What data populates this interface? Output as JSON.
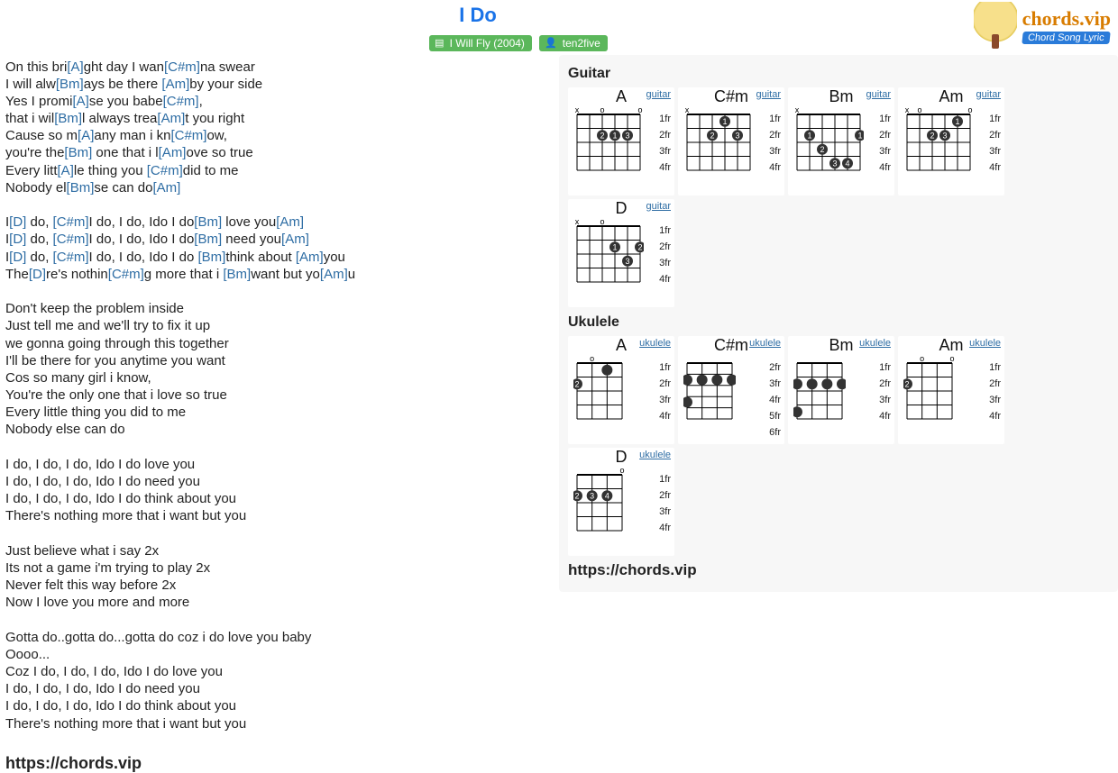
{
  "header": {
    "title": "I Do",
    "album_badge": "I Will Fly (2004)",
    "artist_badge": "ten2five",
    "logo_line1": "chords.vip",
    "logo_line2": "Chord Song Lyric"
  },
  "colors": {
    "chord": "#2e6da4",
    "badge_bg": "#5bb75b",
    "title": "#1a73e8"
  },
  "lyrics": [
    [
      [
        "On this bri",
        null
      ],
      [
        "[A]",
        "c"
      ],
      [
        "ght day I wan",
        null
      ],
      [
        "[C#m]",
        "c"
      ],
      [
        "na swear",
        null
      ]
    ],
    [
      [
        "I will alw",
        null
      ],
      [
        "[Bm]",
        "c"
      ],
      [
        "ays be there ",
        null
      ],
      [
        "[Am]",
        "c"
      ],
      [
        "by your side",
        null
      ]
    ],
    [
      [
        "Yes I promi",
        null
      ],
      [
        "[A]",
        "c"
      ],
      [
        "se you babe",
        null
      ],
      [
        "[C#m]",
        "c"
      ],
      [
        ",",
        null
      ]
    ],
    [
      [
        "that i wil",
        null
      ],
      [
        "[Bm]",
        "c"
      ],
      [
        "l always trea",
        null
      ],
      [
        "[Am]",
        "c"
      ],
      [
        "t you right",
        null
      ]
    ],
    [
      [
        "Cause so m",
        null
      ],
      [
        "[A]",
        "c"
      ],
      [
        "any man i kn",
        null
      ],
      [
        "[C#m]",
        "c"
      ],
      [
        "ow,",
        null
      ]
    ],
    [
      [
        "you're the",
        null
      ],
      [
        "[Bm]",
        "c"
      ],
      [
        " one that i l",
        null
      ],
      [
        "[Am]",
        "c"
      ],
      [
        "ove so true",
        null
      ]
    ],
    [
      [
        "Every litt",
        null
      ],
      [
        "[A]",
        "c"
      ],
      [
        "le thing you ",
        null
      ],
      [
        "[C#m]",
        "c"
      ],
      [
        "did to me",
        null
      ]
    ],
    [
      [
        "Nobody el",
        null
      ],
      [
        "[Bm]",
        "c"
      ],
      [
        "se can do",
        null
      ],
      [
        "[Am]",
        "c"
      ]
    ],
    [
      [
        "",
        null
      ]
    ],
    [
      [
        "I",
        null
      ],
      [
        "[D]",
        "c"
      ],
      [
        " do, ",
        null
      ],
      [
        "[C#m]",
        "c"
      ],
      [
        "I do, I do, Ido I do",
        null
      ],
      [
        "[Bm]",
        "c"
      ],
      [
        " love you",
        null
      ],
      [
        "[Am]",
        "c"
      ]
    ],
    [
      [
        "I",
        null
      ],
      [
        "[D]",
        "c"
      ],
      [
        " do, ",
        null
      ],
      [
        "[C#m]",
        "c"
      ],
      [
        "I do, I do, Ido I do",
        null
      ],
      [
        "[Bm]",
        "c"
      ],
      [
        " need you",
        null
      ],
      [
        "[Am]",
        "c"
      ]
    ],
    [
      [
        "I",
        null
      ],
      [
        "[D]",
        "c"
      ],
      [
        " do, ",
        null
      ],
      [
        "[C#m]",
        "c"
      ],
      [
        "I do, I do, Ido I do ",
        null
      ],
      [
        "[Bm]",
        "c"
      ],
      [
        "think about ",
        null
      ],
      [
        "[Am]",
        "c"
      ],
      [
        "you",
        null
      ]
    ],
    [
      [
        "The",
        null
      ],
      [
        "[D]",
        "c"
      ],
      [
        "re's nothin",
        null
      ],
      [
        "[C#m]",
        "c"
      ],
      [
        "g more that i ",
        null
      ],
      [
        "[Bm]",
        "c"
      ],
      [
        "want but yo",
        null
      ],
      [
        "[Am]",
        "c"
      ],
      [
        "u",
        null
      ]
    ],
    [
      [
        "",
        null
      ]
    ],
    [
      [
        "Don't keep the problem inside",
        null
      ]
    ],
    [
      [
        "Just tell me and we'll try to fix it up",
        null
      ]
    ],
    [
      [
        "we gonna going through this together",
        null
      ]
    ],
    [
      [
        "I'll be there for you anytime you want",
        null
      ]
    ],
    [
      [
        "Cos so many girl i know,",
        null
      ]
    ],
    [
      [
        "You're the only one that i love so true",
        null
      ]
    ],
    [
      [
        "Every little thing you did to me",
        null
      ]
    ],
    [
      [
        "Nobody else can do",
        null
      ]
    ],
    [
      [
        "",
        null
      ]
    ],
    [
      [
        "I do, I do, I do, Ido I do love you",
        null
      ]
    ],
    [
      [
        "I do, I do, I do, Ido I do need you",
        null
      ]
    ],
    [
      [
        "I do, I do, I do, Ido I do think about you",
        null
      ]
    ],
    [
      [
        "There's nothing more that i want but you",
        null
      ]
    ],
    [
      [
        "",
        null
      ]
    ],
    [
      [
        "Just believe what i say 2x",
        null
      ]
    ],
    [
      [
        "Its not a game i'm trying to play 2x",
        null
      ]
    ],
    [
      [
        "Never felt this way before 2x",
        null
      ]
    ],
    [
      [
        "Now I love you more and more",
        null
      ]
    ],
    [
      [
        "",
        null
      ]
    ],
    [
      [
        "Gotta do..gotta do...gotta do coz i do love you baby",
        null
      ]
    ],
    [
      [
        "Oooo...",
        null
      ]
    ],
    [
      [
        "Coz I do, I do, I do, Ido I do love you",
        null
      ]
    ],
    [
      [
        "I do, I do, I do, Ido I do need you",
        null
      ]
    ],
    [
      [
        "I do, I do, I do, Ido I do think about you",
        null
      ]
    ],
    [
      [
        "There's nothing more that i want but you",
        null
      ]
    ]
  ],
  "footer_tag": "https://chords.vip",
  "sidebar": {
    "guitar_title": "Guitar",
    "ukulele_title": "Ukulele",
    "instrument_link": {
      "guitar": "guitar",
      "ukulele": "ukulele"
    },
    "guitar": [
      {
        "name": "A",
        "frets": [
          "1fr",
          "2fr",
          "3fr",
          "4fr"
        ],
        "strings": 6,
        "start": 1,
        "top": [
          "x",
          "",
          "o",
          "",
          "",
          "o"
        ],
        "dots": [
          {
            "s": 2,
            "f": 2,
            "n": "2"
          },
          {
            "s": 3,
            "f": 2,
            "n": "1"
          },
          {
            "s": 4,
            "f": 2,
            "n": "3"
          }
        ]
      },
      {
        "name": "C#m",
        "frets": [
          "1fr",
          "2fr",
          "3fr",
          "4fr"
        ],
        "strings": 6,
        "start": 1,
        "top": [
          "x",
          "",
          "",
          "",
          "",
          ""
        ],
        "dots": [
          {
            "s": 3,
            "f": 1,
            "n": "1"
          },
          {
            "s": 2,
            "f": 2,
            "n": "2"
          },
          {
            "s": 4,
            "f": 2,
            "n": "3"
          }
        ]
      },
      {
        "name": "Bm",
        "frets": [
          "1fr",
          "2fr",
          "3fr",
          "4fr"
        ],
        "strings": 6,
        "start": 1,
        "top": [
          "x",
          "",
          "",
          "",
          "",
          ""
        ],
        "dots": [
          {
            "s": 1,
            "f": 2,
            "n": "1"
          },
          {
            "s": 5,
            "f": 2,
            "n": "1"
          },
          {
            "s": 2,
            "f": 3,
            "n": "2"
          },
          {
            "s": 3,
            "f": 4,
            "n": "3"
          },
          {
            "s": 4,
            "f": 4,
            "n": "4"
          }
        ]
      },
      {
        "name": "Am",
        "frets": [
          "1fr",
          "2fr",
          "3fr",
          "4fr"
        ],
        "strings": 6,
        "start": 1,
        "top": [
          "x",
          "o",
          "",
          "",
          "",
          "o"
        ],
        "dots": [
          {
            "s": 4,
            "f": 1,
            "n": "1"
          },
          {
            "s": 2,
            "f": 2,
            "n": "2"
          },
          {
            "s": 3,
            "f": 2,
            "n": "3"
          }
        ]
      },
      {
        "name": "D",
        "frets": [
          "1fr",
          "2fr",
          "3fr",
          "4fr"
        ],
        "strings": 6,
        "start": 1,
        "top": [
          "x",
          "",
          "o",
          "",
          "",
          ""
        ],
        "dots": [
          {
            "s": 3,
            "f": 2,
            "n": "1"
          },
          {
            "s": 5,
            "f": 2,
            "n": "2"
          },
          {
            "s": 4,
            "f": 3,
            "n": "3"
          }
        ]
      }
    ],
    "ukulele": [
      {
        "name": "A",
        "frets": [
          "1fr",
          "2fr",
          "3fr",
          "4fr"
        ],
        "strings": 4,
        "start": 1,
        "top": [
          "",
          "o",
          "",
          ""
        ],
        "dots": [
          {
            "s": 2,
            "f": 1,
            "n": ""
          },
          {
            "s": 0,
            "f": 2,
            "n": "2"
          }
        ]
      },
      {
        "name": "C#m",
        "frets": [
          "2fr",
          "3fr",
          "4fr",
          "5fr",
          "6fr"
        ],
        "strings": 4,
        "start": 2,
        "top": [],
        "dots": [
          {
            "s": 0,
            "f": 3,
            "n": ""
          },
          {
            "s": 1,
            "f": 3,
            "n": ""
          },
          {
            "s": 2,
            "f": 3,
            "n": ""
          },
          {
            "s": 3,
            "f": 3,
            "n": ""
          },
          {
            "s": 0,
            "f": 5,
            "n": ""
          }
        ]
      },
      {
        "name": "Bm",
        "frets": [
          "1fr",
          "2fr",
          "3fr",
          "4fr"
        ],
        "strings": 4,
        "start": 1,
        "top": [],
        "dots": [
          {
            "s": 0,
            "f": 2,
            "n": ""
          },
          {
            "s": 1,
            "f": 2,
            "n": ""
          },
          {
            "s": 2,
            "f": 2,
            "n": ""
          },
          {
            "s": 3,
            "f": 2,
            "n": ""
          },
          {
            "s": 0,
            "f": 4,
            "n": ""
          }
        ]
      },
      {
        "name": "Am",
        "frets": [
          "1fr",
          "2fr",
          "3fr",
          "4fr"
        ],
        "strings": 4,
        "start": 1,
        "top": [
          "",
          "o",
          "",
          "o"
        ],
        "dots": [
          {
            "s": 0,
            "f": 2,
            "n": "2"
          }
        ]
      },
      {
        "name": "D",
        "frets": [
          "1fr",
          "2fr",
          "3fr",
          "4fr"
        ],
        "strings": 4,
        "start": 1,
        "top": [
          "",
          "",
          "",
          "o"
        ],
        "dots": [
          {
            "s": 0,
            "f": 2,
            "n": "2"
          },
          {
            "s": 1,
            "f": 2,
            "n": "3"
          },
          {
            "s": 2,
            "f": 2,
            "n": "4"
          }
        ]
      }
    ],
    "site_tag": "https://chords.vip"
  }
}
